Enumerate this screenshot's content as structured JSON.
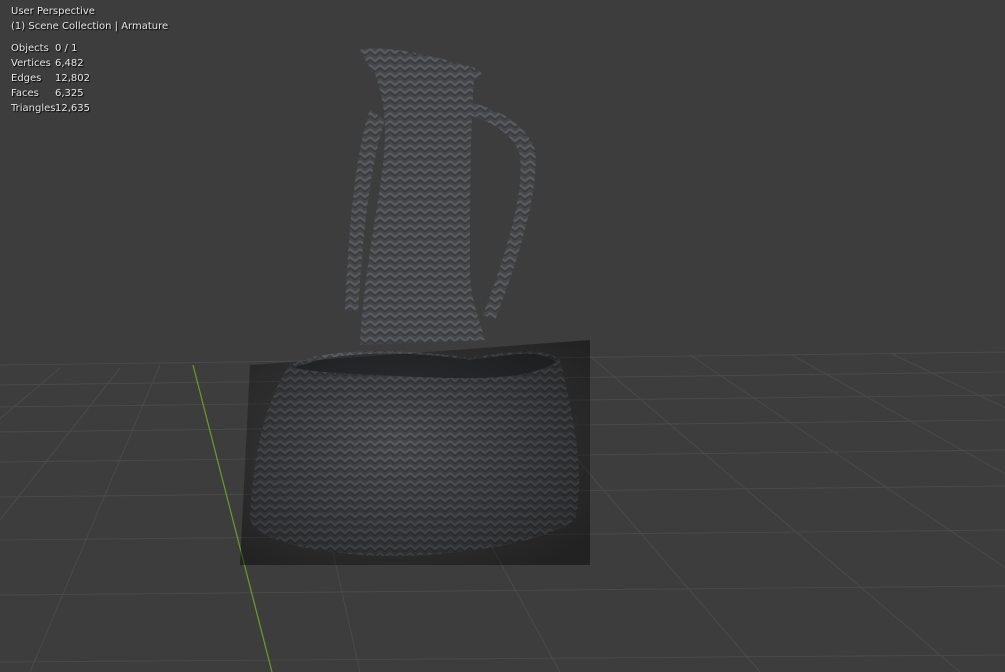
{
  "viewport": {
    "view_name": "User Perspective",
    "collection_line": "(1) Scene Collection | Armature"
  },
  "stats": [
    {
      "label": "Objects",
      "value": "0 / 1"
    },
    {
      "label": "Vertices",
      "value": "6,482"
    },
    {
      "label": "Edges",
      "value": "12,802"
    },
    {
      "label": "Faces",
      "value": "6,325"
    },
    {
      "label": "Triangles",
      "value": "12,635"
    }
  ],
  "colors": {
    "background": "#3d3d3d",
    "grid": "#4a4a4a",
    "y_axis": "#6f9a2e",
    "mesh": "#4b4d50"
  }
}
